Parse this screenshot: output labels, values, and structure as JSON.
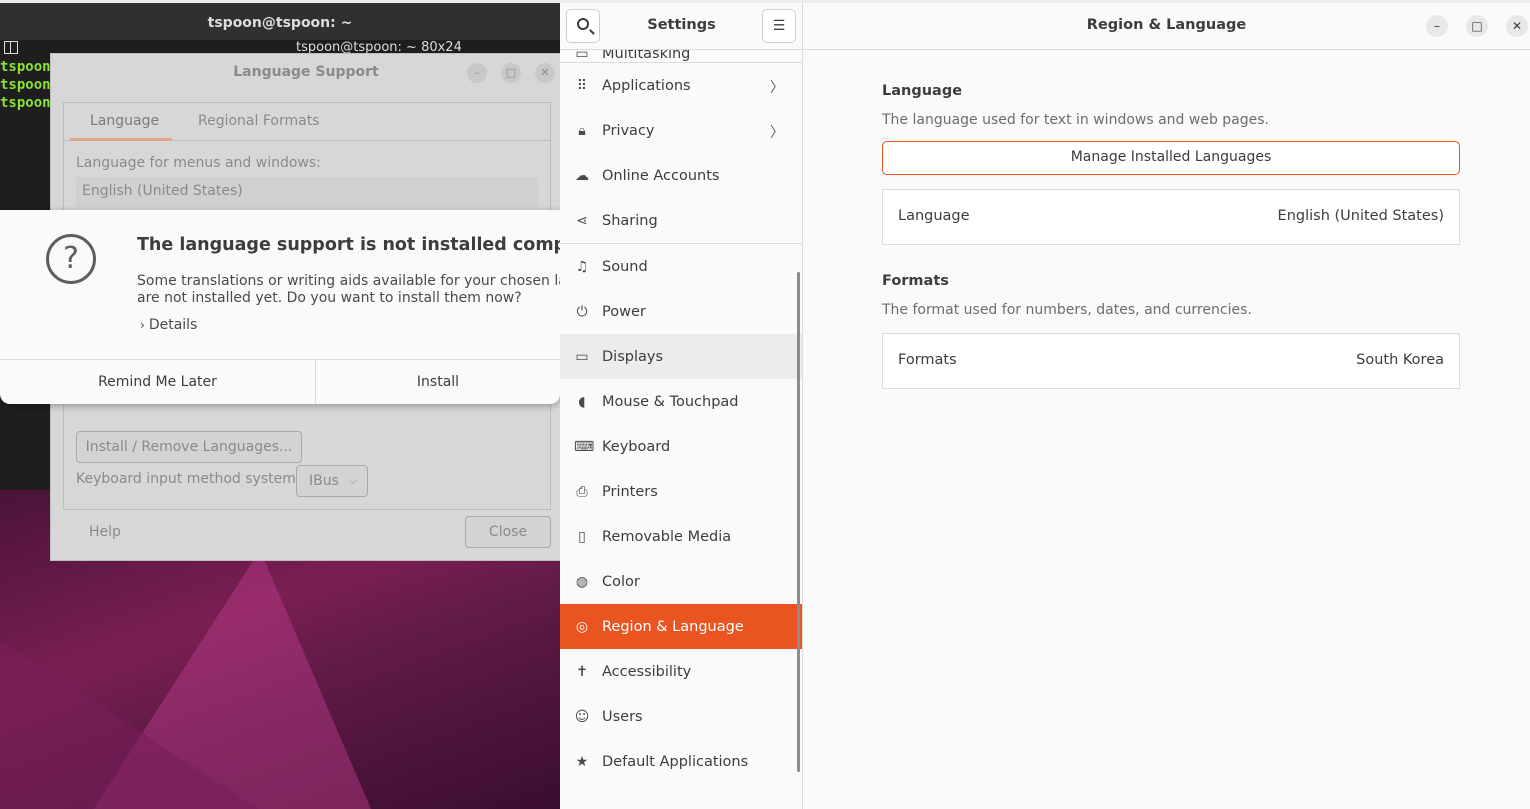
{
  "terminal": {
    "title": "tspoon@tspoon: ~",
    "subtitle": "tspoon@tspoon: ~ 80x24",
    "lines": [
      "tspoon",
      "tspoon",
      "tspoon"
    ]
  },
  "language_support": {
    "title": "Language Support",
    "tabs": [
      "Language",
      "Regional Formats"
    ],
    "label_menus": "Language for menus and windows:",
    "list_item": "English (United States)",
    "install_remove_button": "Install / Remove Languages...",
    "keyboard_label": "Keyboard input method system:",
    "keyboard_value": "IBus",
    "help_button": "Help",
    "close_button": "Close"
  },
  "alert": {
    "title": "The language support is not installed completely",
    "body_line1": "Some translations or writing aids available for your chosen lang",
    "body_line2": "are not installed yet. Do you want to install them now?",
    "details": "Details",
    "remind_button": "Remind Me Later",
    "install_button": "Install"
  },
  "settings": {
    "title": "Settings",
    "partial_item": "Multitasking",
    "items": [
      {
        "label": "Applications",
        "icon": "grid-icon",
        "chevron": true
      },
      {
        "label": "Privacy",
        "icon": "lock-icon",
        "chevron": true
      },
      {
        "label": "Online Accounts",
        "icon": "cloud-icon",
        "chevron": false
      },
      {
        "label": "Sharing",
        "icon": "share-icon",
        "chevron": false
      },
      {
        "label": "Sound",
        "icon": "music-note-icon",
        "chevron": false
      },
      {
        "label": "Power",
        "icon": "power-icon",
        "chevron": false
      },
      {
        "label": "Displays",
        "icon": "display-icon",
        "chevron": false
      },
      {
        "label": "Mouse & Touchpad",
        "icon": "mouse-icon",
        "chevron": false
      },
      {
        "label": "Keyboard",
        "icon": "keyboard-icon",
        "chevron": false
      },
      {
        "label": "Printers",
        "icon": "printer-icon",
        "chevron": false
      },
      {
        "label": "Removable Media",
        "icon": "usb-icon",
        "chevron": false
      },
      {
        "label": "Color",
        "icon": "color-icon",
        "chevron": false
      },
      {
        "label": "Region & Language",
        "icon": "globe-icon",
        "chevron": false
      },
      {
        "label": "Accessibility",
        "icon": "accessibility-icon",
        "chevron": false
      },
      {
        "label": "Users",
        "icon": "users-icon",
        "chevron": false
      },
      {
        "label": "Default Applications",
        "icon": "star-icon",
        "chevron": false
      }
    ],
    "selected": "Region & Language",
    "accent_color": "#e95420"
  },
  "region": {
    "title": "Region & Language",
    "language_section": "Language",
    "language_desc": "The language used for text in windows and web pages.",
    "manage_button": "Manage Installed Languages",
    "language_row_label": "Language",
    "language_row_value": "English (United States)",
    "formats_section": "Formats",
    "formats_desc": "The format used for numbers, dates, and currencies.",
    "formats_row_label": "Formats",
    "formats_row_value": "South Korea"
  }
}
